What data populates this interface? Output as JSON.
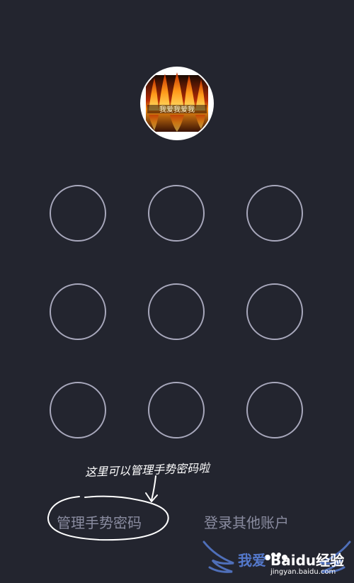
{
  "avatar": {
    "text": "我爱我爱我"
  },
  "gesture_grid": {
    "dots": [
      "dot-1",
      "dot-2",
      "dot-3",
      "dot-4",
      "dot-5",
      "dot-6",
      "dot-7",
      "dot-8",
      "dot-9"
    ]
  },
  "links": {
    "manage_gesture": "管理手势密码",
    "login_other": "登录其他账户"
  },
  "annotation": {
    "text": "这里可以管理手势密码啦"
  },
  "watermark": {
    "cn": "我爱",
    "brand": "Baidu经验",
    "url": "jingyan.baidu.com"
  },
  "colors": {
    "background": "#23252f",
    "dot_stroke": "#a8a8bc",
    "link_text": "#8a8ca0"
  }
}
